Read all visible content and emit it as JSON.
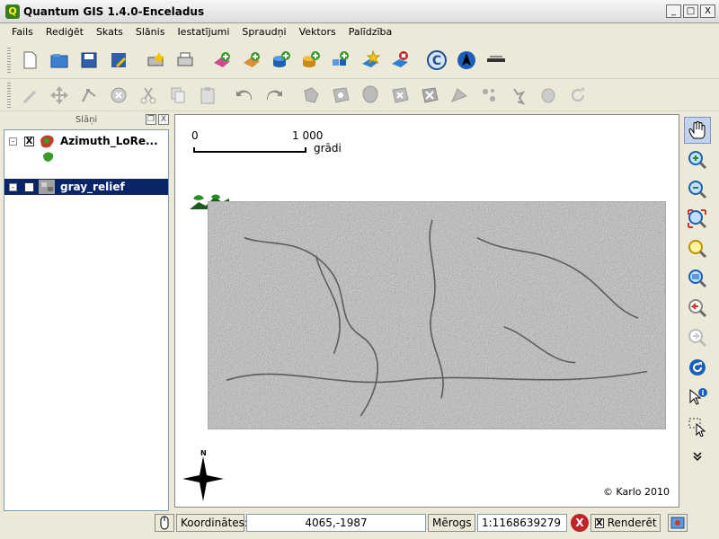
{
  "window": {
    "title": "Quantum GIS 1.4.0-Enceladus",
    "app_icon": "Q",
    "minimize": "_",
    "maximize": "□",
    "close": "X"
  },
  "menubar": [
    "Fails",
    "Rediģēt",
    "Skats",
    "Slānis",
    "Iestatījumi",
    "Spraudņi",
    "Vektors",
    "Palīdzība"
  ],
  "toolbar1_icons": [
    "new-project-icon",
    "open-project-icon",
    "save-project-icon",
    "save-as-icon",
    "print-composer-icon",
    "print-icon",
    "add-vector-layer-icon",
    "add-raster-layer-icon",
    "add-postgis-layer-icon",
    "add-spatialite-layer-icon",
    "add-wms-layer-icon",
    "new-vector-layer-icon",
    "remove-layer-icon",
    "copyright-label-icon",
    "north-arrow-icon",
    "scale-bar-icon"
  ],
  "toolbar2_icons": [
    "toggle-editing-icon",
    "move-feature-icon",
    "node-tool-icon",
    "delete-selected-icon",
    "cut-features-icon",
    "copy-features-icon",
    "paste-features-icon",
    "undo-icon",
    "redo-icon",
    "simplify-feature-icon",
    "add-ring-icon",
    "add-island-icon",
    "delete-ring-icon",
    "delete-part-icon",
    "reshape-features-icon",
    "split-features-icon",
    "merge-features-icon",
    "rotate-point-symbols-icon"
  ],
  "layers_panel": {
    "title": "Slāņi",
    "float_btn": "❐",
    "close_btn": "X",
    "layers": [
      {
        "name": "Azimuth_LoRe...",
        "expanded": true,
        "checked": "X",
        "expander": "-"
      },
      {
        "name": "gray_relief",
        "expanded": true,
        "checked": "X",
        "expander": "-",
        "selected": true
      }
    ]
  },
  "map": {
    "scale_start": "0",
    "scale_end": "1 000",
    "scale_unit": "grādi",
    "north": "N",
    "copyright": "© Karlo 2010"
  },
  "map_nav_icons": [
    "pan-icon",
    "zoom-in-icon",
    "zoom-out-icon",
    "zoom-full-icon",
    "zoom-to-selection-icon",
    "zoom-to-layer-icon",
    "zoom-last-icon",
    "zoom-next-icon",
    "refresh-icon",
    "identify-icon",
    "select-icon",
    "more-icon"
  ],
  "statusbar": {
    "coords_label": "Koordinātes:",
    "coords_value": "4065,-1987",
    "scale_label": "Mērogs",
    "scale_value": "1:1168639279",
    "render_label": "Renderēt",
    "render_checked": "X"
  },
  "colors": {
    "selection": "#0a246a",
    "accent_green": "#3a9a2a",
    "accent_blue": "#1c5fb8"
  }
}
